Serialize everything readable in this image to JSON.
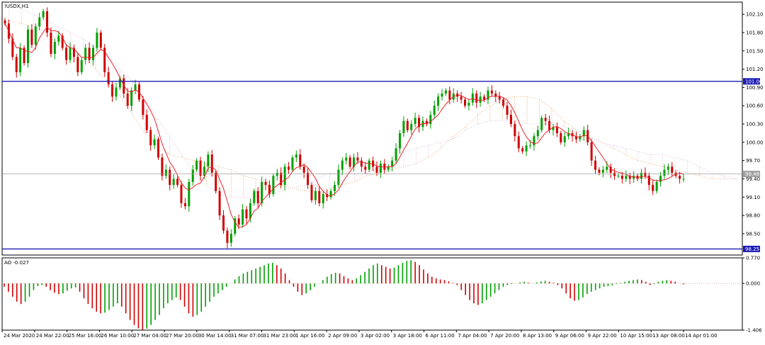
{
  "chart_data": [
    {
      "type": "candlestick",
      "title": "!USDX,H1",
      "ylim": [
        98.15,
        102.3
      ],
      "y_ticks": [
        "102.10",
        "101.80",
        "101.50",
        "101.20",
        "100.90",
        "100.60",
        "100.30",
        "100.00",
        "99.70",
        "99.40",
        "99.10",
        "98.80",
        "98.50"
      ],
      "y_tick_values": [
        102.1,
        101.8,
        101.5,
        101.2,
        100.9,
        100.6,
        100.3,
        100.0,
        99.7,
        99.4,
        99.1,
        98.8,
        98.5
      ],
      "x_labels": [
        "24 Mar 2020",
        "24 Mar 22:00",
        "25 Mar 16:00",
        "26 Mar 10:00",
        "27 Mar 04:00",
        "27 Mar 20:00",
        "30 Mar 14:00",
        "31 Mar 07:00",
        "31 Mar 23:00",
        "1 Apr 16:00",
        "2 Apr 09:00",
        "3 Apr 02:00",
        "3 Apr 18:00",
        "6 Apr 11:00",
        "7 Apr 04:00",
        "7 Apr 20:00",
        "8 Apr 13:00",
        "9 Apr 06:00",
        "9 Apr 22:00",
        "10 Apr 15:00",
        "13 Apr 08:00",
        "14 Apr 01:00"
      ],
      "horizontal_lines": [
        {
          "value": 101.0,
          "label": "101.00",
          "color": "#1c1cb4"
        },
        {
          "value": 98.25,
          "label": "98.25",
          "color": "#1c1cb4"
        },
        {
          "value": 99.48,
          "label": "99.48",
          "color": "#a0a0a0"
        }
      ],
      "close_series": [
        101.95,
        101.7,
        101.4,
        101.15,
        101.55,
        101.3,
        101.85,
        101.6,
        101.9,
        102.05,
        102.15,
        101.8,
        101.45,
        101.65,
        101.75,
        101.55,
        101.35,
        101.55,
        101.4,
        101.15,
        101.35,
        101.55,
        101.35,
        101.55,
        101.8,
        101.55,
        101.15,
        100.95,
        100.75,
        100.9,
        101.05,
        100.8,
        100.6,
        100.85,
        100.95,
        100.7,
        100.45,
        100.2,
        99.95,
        100.05,
        99.75,
        99.45,
        99.55,
        99.3,
        99.4,
        99.3,
        99.0,
        98.95,
        99.35,
        99.55,
        99.7,
        99.45,
        99.6,
        99.8,
        99.5,
        99.2,
        98.8,
        98.55,
        98.35,
        98.5,
        98.75,
        98.65,
        98.9,
        98.75,
        99.0,
        99.2,
        99.0,
        99.35,
        99.3,
        99.15,
        99.45,
        99.5,
        99.3,
        99.6,
        99.55,
        99.75,
        99.8,
        99.6,
        99.5,
        99.3,
        99.05,
        99.2,
        99.0,
        99.15,
        99.1,
        99.2,
        99.3,
        99.55,
        99.7,
        99.75,
        99.6,
        99.75,
        99.7,
        99.6,
        99.55,
        99.7,
        99.6,
        99.5,
        99.65,
        99.55,
        99.6,
        99.7,
        99.9,
        100.15,
        100.35,
        100.2,
        100.3,
        100.4,
        100.25,
        100.35,
        100.3,
        100.45,
        100.6,
        100.75,
        100.8,
        100.85,
        100.7,
        100.8,
        100.75,
        100.7,
        100.6,
        100.65,
        100.8,
        100.65,
        100.75,
        100.7,
        100.85,
        100.8,
        100.75,
        100.7,
        100.6,
        100.45,
        100.3,
        100.1,
        99.9,
        99.85,
        99.95,
        99.95,
        100.1,
        100.2,
        100.4,
        100.35,
        100.2,
        100.25,
        100.15,
        100.0,
        100.1,
        100.15,
        100.1,
        100.05,
        100.1,
        100.2,
        100.0,
        99.7,
        99.55,
        99.5,
        99.55,
        99.6,
        99.5,
        99.45,
        99.45,
        99.4,
        99.45,
        99.4,
        99.45,
        99.4,
        99.5,
        99.45,
        99.3,
        99.2,
        99.35,
        99.45,
        99.55,
        99.6,
        99.5,
        99.45,
        99.4,
        99.4
      ],
      "cloud_a": [
        102.0,
        101.95,
        101.9,
        101.8,
        101.7,
        101.55,
        101.4,
        101.2,
        101.0,
        100.75,
        100.45,
        100.15,
        99.95,
        99.8,
        99.75,
        99.7,
        99.65,
        99.6,
        99.55,
        99.45,
        99.4,
        99.35,
        99.3,
        99.25,
        99.2,
        99.2,
        99.25,
        99.3,
        99.35,
        99.45,
        99.5,
        99.55,
        99.6,
        99.65,
        99.75,
        99.9,
        100.1,
        100.25,
        100.45,
        100.6,
        100.7,
        100.75,
        100.75,
        100.7,
        100.55,
        100.35,
        100.2,
        100.1,
        100.0,
        99.9,
        99.8,
        99.7,
        99.65,
        99.6,
        99.55,
        99.5,
        99.45,
        99.4,
        99.4,
        99.4
      ],
      "cloud_b": [
        102.3,
        102.2,
        102.1,
        102.0,
        101.9,
        101.8,
        101.7,
        101.55,
        101.4,
        101.2,
        101.0,
        100.7,
        100.4,
        100.1,
        99.8,
        99.5,
        99.3,
        99.15,
        99.1,
        99.1,
        99.1,
        99.15,
        99.2,
        99.25,
        99.3,
        99.4,
        99.5,
        99.5,
        99.5,
        99.5,
        99.6,
        99.7,
        99.85,
        99.9,
        99.95,
        100.0,
        100.05,
        100.2,
        100.3,
        100.35,
        100.35,
        100.35,
        100.3,
        100.3,
        100.3,
        100.25,
        100.2,
        100.1,
        100.0,
        99.95,
        99.9,
        99.85,
        99.8,
        99.8,
        99.75,
        99.7,
        99.6,
        99.5,
        99.45,
        99.4
      ],
      "up_color": "#00a000",
      "down_color": "#d00000",
      "ma_color": "#e8242a",
      "cloud_a_color": "#e8a06a",
      "cloud_b_color": "#d8b0d8"
    },
    {
      "type": "bar",
      "title": "AO -0.027",
      "ylim": [
        -1.406,
        0.77
      ],
      "y_ticks": [
        "0.770",
        "0.000",
        "-1.406"
      ],
      "y_tick_values": [
        0.77,
        0.0,
        -1.406
      ],
      "values": [
        -0.1,
        -0.25,
        -0.4,
        -0.55,
        -0.62,
        -0.55,
        -0.4,
        -0.2,
        -0.08,
        -0.05,
        -0.1,
        -0.2,
        -0.28,
        -0.32,
        -0.3,
        -0.22,
        -0.15,
        -0.12,
        -0.25,
        -0.45,
        -0.62,
        -0.75,
        -0.85,
        -0.9,
        -0.88,
        -0.8,
        -0.7,
        -0.6,
        -0.7,
        -0.9,
        -1.1,
        -1.25,
        -1.35,
        -1.4,
        -1.36,
        -1.25,
        -1.1,
        -0.95,
        -0.75,
        -0.6,
        -0.5,
        -0.42,
        -0.5,
        -0.7,
        -0.9,
        -1.0,
        -0.95,
        -0.85,
        -0.7,
        -0.55,
        -0.4,
        -0.3,
        -0.2,
        -0.1,
        0.0,
        0.12,
        0.22,
        0.3,
        0.35,
        0.4,
        0.45,
        0.5,
        0.55,
        0.6,
        0.62,
        0.55,
        0.45,
        0.3,
        0.1,
        -0.1,
        -0.25,
        -0.35,
        -0.3,
        -0.2,
        -0.1,
        0.0,
        0.1,
        0.2,
        0.28,
        0.32,
        0.3,
        0.22,
        0.15,
        0.1,
        0.15,
        0.25,
        0.35,
        0.45,
        0.55,
        0.6,
        0.55,
        0.5,
        0.45,
        0.48,
        0.55,
        0.62,
        0.68,
        0.7,
        0.65,
        0.55,
        0.42,
        0.3,
        0.2,
        0.15,
        0.12,
        0.1,
        0.06,
        0.02,
        -0.05,
        -0.2,
        -0.35,
        -0.5,
        -0.6,
        -0.65,
        -0.6,
        -0.5,
        -0.4,
        -0.3,
        -0.2,
        -0.1,
        -0.05,
        -0.02,
        0.0,
        0.03,
        0.05,
        0.02,
        0.0,
        0.03,
        0.06,
        0.08,
        0.05,
        0.02,
        -0.05,
        -0.15,
        -0.3,
        -0.45,
        -0.52,
        -0.5,
        -0.42,
        -0.32,
        -0.25,
        -0.2,
        -0.15,
        -0.1,
        -0.08,
        -0.06,
        -0.02,
        0.02,
        0.05,
        0.08,
        0.1,
        0.12,
        0.1,
        0.05,
        -0.05,
        -0.02,
        0.05,
        0.08,
        0.1,
        0.08,
        0.05,
        0.0,
        -0.027
      ],
      "up_color": "#00a000",
      "down_color": "#d00000"
    }
  ]
}
